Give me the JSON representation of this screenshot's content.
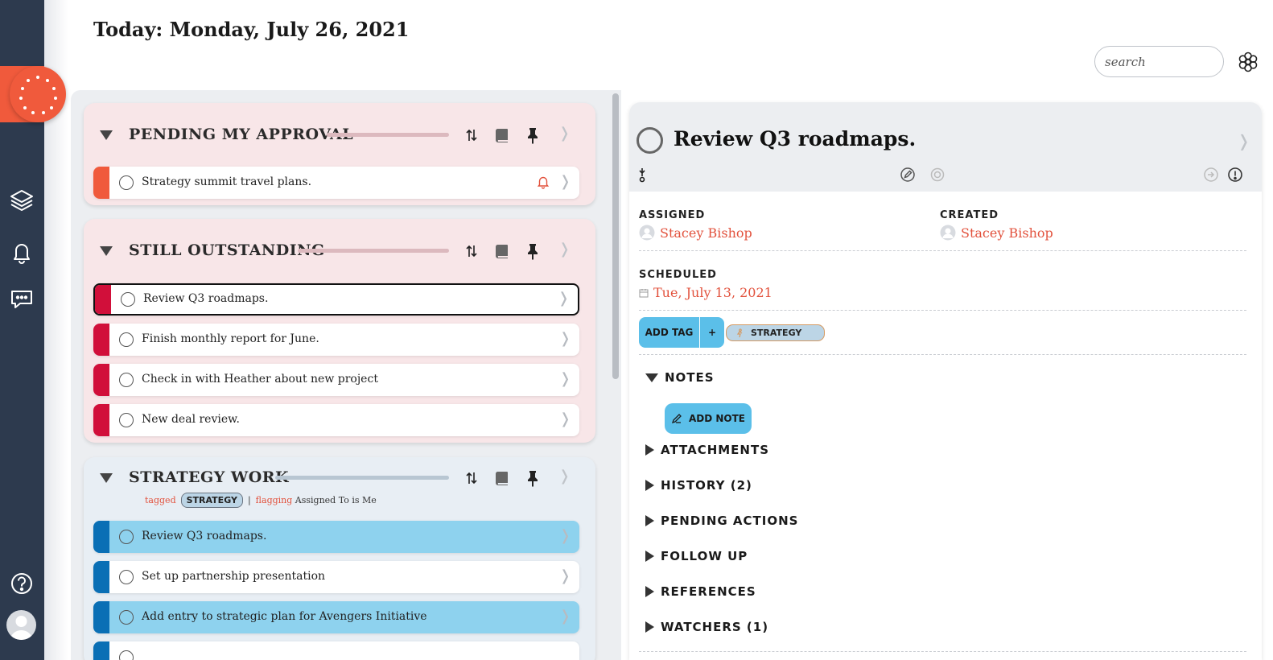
{
  "header": {
    "title": "Today: Monday, July 26, 2021",
    "search_placeholder": "search"
  },
  "sidebar": {
    "icons": [
      "layers-icon",
      "bell-icon",
      "chat-icon",
      "help-icon",
      "avatar"
    ]
  },
  "sections": [
    {
      "title": "PENDING MY APPROVAL",
      "tasks": [
        {
          "text": "Strategy summit travel plans.",
          "color": "#f05a3c",
          "alert": true
        }
      ]
    },
    {
      "title": "STILL OUTSTANDING",
      "tasks": [
        {
          "text": "Review Q3 roadmaps.",
          "color": "#d10f3a",
          "selected": true
        },
        {
          "text": "Finish monthly report for June.",
          "color": "#d10f3a"
        },
        {
          "text": "Check in with Heather about new project",
          "color": "#d10f3a"
        },
        {
          "text": "New deal review.",
          "color": "#d10f3a"
        }
      ]
    },
    {
      "title": "STRATEGY WORK",
      "filter": {
        "tagged_label": "tagged",
        "tag": "STRATEGY",
        "separator": "|",
        "flagging_label": "flagging",
        "flagging_value": "Assigned To is Me"
      },
      "tasks": [
        {
          "text": "Review Q3 roadmaps.",
          "color": "#0a6fb5",
          "highlight": true
        },
        {
          "text": "Set up partnership presentation",
          "color": "#0a6fb5"
        },
        {
          "text": "Add entry to strategic plan for Avengers Initiative",
          "color": "#0a6fb5",
          "highlight": true
        }
      ]
    }
  ],
  "detail": {
    "title": "Review Q3 roadmaps.",
    "assigned_label": "ASSIGNED",
    "assigned_value": "Stacey Bishop",
    "created_label": "CREATED",
    "created_value": "Stacey Bishop",
    "scheduled_label": "SCHEDULED",
    "scheduled_value": "Tue, July 13, 2021",
    "add_tag_label": "ADD TAG",
    "add_tag_plus": "+",
    "tag": "STRATEGY",
    "notes_label": "NOTES",
    "add_note_label": "ADD NOTE",
    "sections": [
      "ATTACHMENTS",
      "HISTORY (2)",
      "PENDING ACTIONS",
      "FOLLOW UP",
      "REFERENCES",
      "WATCHERS (1)"
    ]
  },
  "colors": {
    "accent": "#f05a3c",
    "sidebar": "#2d3a4e",
    "link": "#e2513c",
    "button": "#5bbfe9"
  }
}
